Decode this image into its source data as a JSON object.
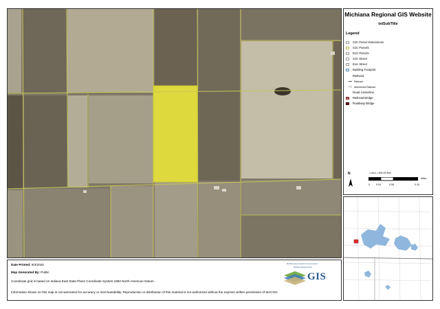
{
  "header": {
    "title": "Michiana Regional GIS Website",
    "subtitle": "txtSubTitle"
  },
  "legend": {
    "title": "Legend",
    "items": [
      {
        "label": "SJC Parcel Dimensions",
        "type": "box",
        "fill": "#ffffff",
        "stroke": "#999999"
      },
      {
        "label": "SJC Parcels",
        "type": "box",
        "fill": "#ffffff",
        "stroke": "#b5b55a"
      },
      {
        "label": "ELK Parcels",
        "type": "box",
        "fill": "#ffffff",
        "stroke": "#999999"
      },
      {
        "label": "SJC Street",
        "type": "box",
        "fill": "#ffffff",
        "stroke": "#999999"
      },
      {
        "label": "ELK Street",
        "type": "box",
        "fill": "#ffffff",
        "stroke": "#999999"
      },
      {
        "label": "Building Footprint",
        "type": "box",
        "fill": "#cfe3f2",
        "stroke": "#6b8fb0"
      },
      {
        "label": "Railroad",
        "type": "none"
      },
      {
        "label": "Railroad",
        "type": "line",
        "sub": true
      },
      {
        "label": "Abandoned Railroad",
        "type": "dotted",
        "sub": true
      },
      {
        "label": "Road Centerline",
        "type": "none"
      },
      {
        "label": "Railroad Bridge",
        "type": "box",
        "fill": "#d26a6a",
        "stroke": "#7a2a2a"
      },
      {
        "label": "Roadway Bridge",
        "type": "box",
        "fill": "#6a1a1a",
        "stroke": "#3a0a0a"
      }
    ]
  },
  "north_arrow": {
    "label": "N"
  },
  "scale": {
    "ratio_text": "1 inch = 600.00 feet",
    "ticks": [
      "0",
      "0.04",
      "0.08",
      "0.15"
    ],
    "units": "Miles"
  },
  "footer": {
    "date_label": "Date Printed:",
    "date_value": "9/3/2020",
    "generated_label": "Map Generated By:",
    "generated_value": "Public",
    "coordinate_note": "Coordinate grid is based on Indiana East State Plane Coordinate System 1983 North American Datum.",
    "disclaimer": "Information shown on this map is not warranted for accuracy or merchantability. Reproduction or distribution of this material is not authorized without the express written permission of MACOG."
  },
  "logo": {
    "text": "GIS",
    "caption_line1": "Michiana Area Council of Governments",
    "caption_line2": "Michiana Regional GIS"
  },
  "colors": {
    "selected_parcel": "#e6e23a",
    "parcel_line": "#c9c65a",
    "overview_water": "#8fb6dc",
    "overview_marker": "#e03030"
  }
}
